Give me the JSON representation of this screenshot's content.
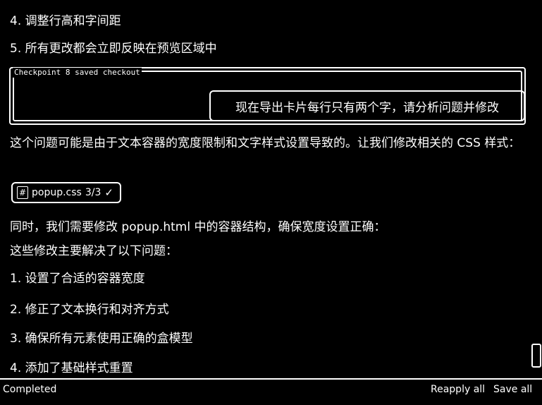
{
  "chat": {
    "lines_top": [
      "4. 调整行高和字间距",
      "5. 所有更改都会立即反映在预览区域中"
    ],
    "checkpoint": {
      "label": "Checkpoint 8 saved checkout",
      "user_message": "现在导出卡片每行只有两个字，请分析问题并修改"
    },
    "reply_paragraph": "这个问题可能是由于文本容器的宽度限制和文字样式设置导致的。让我们修改相关的 CSS 样式：",
    "file_chip": {
      "icon": "#",
      "filename": "popup.css",
      "count": "3/3",
      "status_icon": "✓"
    },
    "paragraph_2": "同时，我们需要修改 popup.html 中的容器结构，确保宽度设置正确：",
    "paragraph_3": "这些修改主要解决了以下问题：",
    "fix_list": [
      "1. 设置了合适的容器宽度",
      "2. 修正了文本换行和对齐方式",
      "3. 确保所有元素使用正确的盒模型",
      "4. 添加了基础样式重置"
    ]
  },
  "statusbar": {
    "status": "Completed",
    "reapply_label": "Reapply all",
    "save_label": "Save all"
  }
}
